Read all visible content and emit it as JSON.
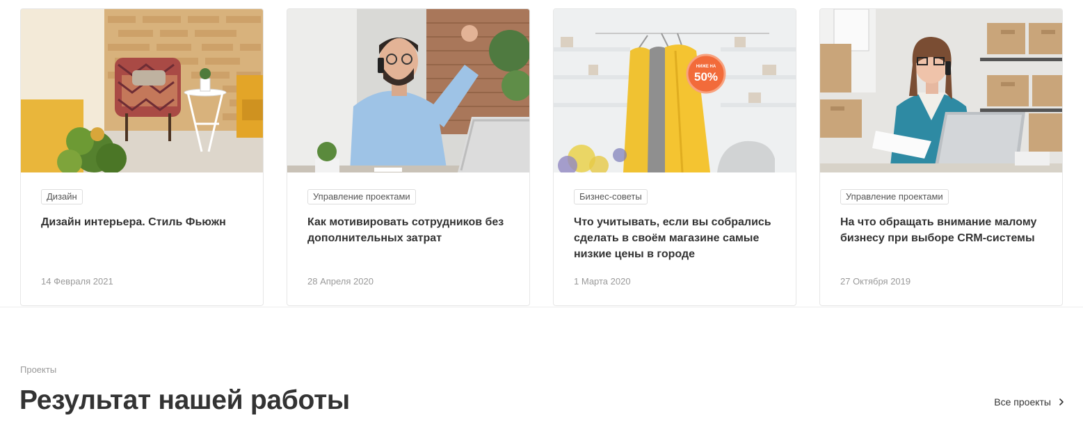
{
  "cards": [
    {
      "tag": "Дизайн",
      "title": "Дизайн интерьера. Стиль Фьюжн",
      "date": "14 Февраля 2021",
      "image": "interior-armchair-photo"
    },
    {
      "tag": "Управление проектами",
      "title": "Как мотивировать сотрудников без дополнительных затрат",
      "date": "28 Апреля 2020",
      "image": "man-on-phone-photo"
    },
    {
      "tag": "Бизнес-советы",
      "title": "Что учитывать, если вы собрались сделать в своём магазине самые низкие цены в городе",
      "date": "1 Марта 2020",
      "image": "clothes-rack-sale-photo",
      "badge_small": "НИЖЕ НА",
      "badge_big": "50%"
    },
    {
      "tag": "Управление проектами",
      "title": "На что обращать внимание малому бизнесу при выборе CRM-системы",
      "date": "27 Октября 2019",
      "image": "woman-laptop-boxes-photo"
    }
  ],
  "section": {
    "label": "Проекты",
    "title": "Результат нашей работы",
    "all_link": "Все проекты",
    "all_link_icon": "chevron-right-icon"
  }
}
